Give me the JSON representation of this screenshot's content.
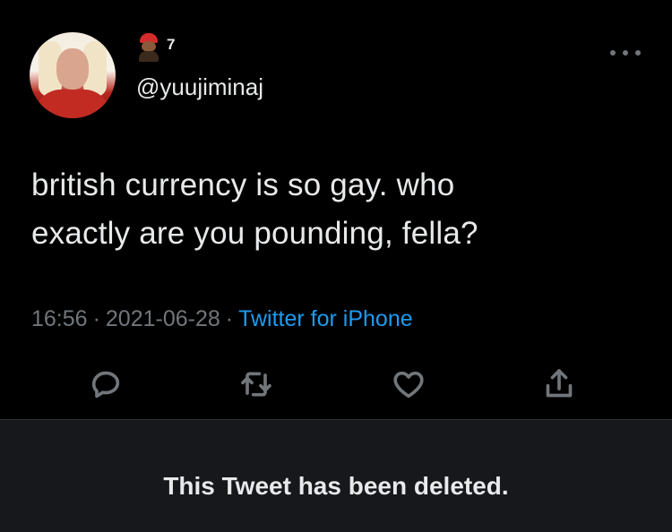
{
  "author": {
    "display_name_number": "7",
    "handle": "@yuujiminaj",
    "avatar": "avatar-photo",
    "name_emoji": "firefighter-emoji"
  },
  "tweet": {
    "text_line1": "british currency is so gay. who",
    "text_line2": "exactly are you pounding, fella?",
    "time": "16:56",
    "date": "2021-06-28",
    "source": "Twitter for iPhone",
    "separator": "·"
  },
  "actions": {
    "reply_icon": "reply-icon",
    "retweet_icon": "retweet-icon",
    "like_icon": "heart-icon",
    "share_icon": "share-icon",
    "more_icon": "more-options-icon"
  },
  "notice": {
    "deleted_text": "This Tweet has been deleted."
  },
  "colors": {
    "background": "#000000",
    "text": "#e7e9ea",
    "muted": "#71767b",
    "link": "#1d9bf0",
    "notice_bg": "#16181c"
  }
}
